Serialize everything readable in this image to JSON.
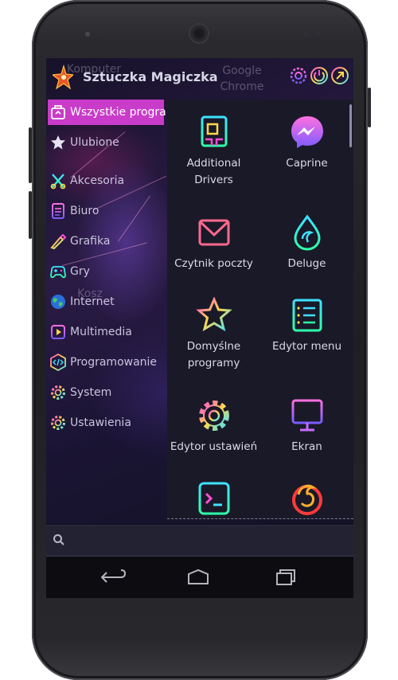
{
  "header": {
    "title": "Sztuczka Magiczka",
    "icons": [
      "settings-icon",
      "power-icon",
      "external-icon"
    ]
  },
  "desktop": {
    "ghost_icons": {
      "komputer": "Komputer",
      "chrome": "Google\nChrome",
      "kosz": "Kosz"
    }
  },
  "categories": [
    {
      "label": "Wszystkie programy",
      "icon": "all-programs-icon",
      "active": true
    },
    {
      "label": "Ulubione",
      "icon": "star-icon"
    },
    {
      "label": "Akcesoria",
      "icon": "accessories-icon"
    },
    {
      "label": "Biuro",
      "icon": "office-icon"
    },
    {
      "label": "Grafika",
      "icon": "graphics-icon"
    },
    {
      "label": "Gry",
      "icon": "gamepad-icon"
    },
    {
      "label": "Internet",
      "icon": "globe-icon"
    },
    {
      "label": "Multimedia",
      "icon": "multimedia-icon"
    },
    {
      "label": "Programowanie",
      "icon": "code-icon"
    },
    {
      "label": "System",
      "icon": "gear-icon"
    },
    {
      "label": "Ustawienia",
      "icon": "gear-icon"
    }
  ],
  "apps": [
    {
      "label": "Additional\nDrivers",
      "icon": "chip-icon"
    },
    {
      "label": "Caprine",
      "icon": "messenger-icon"
    },
    {
      "label": "Czytnik poczty",
      "icon": "mail-icon"
    },
    {
      "label": "Deluge",
      "icon": "droplet-icon"
    },
    {
      "label": "Domyślne\nprogramy",
      "icon": "star-icon"
    },
    {
      "label": "Edytor menu",
      "icon": "list-icon"
    },
    {
      "label": "Edytor ustawień",
      "icon": "gear-icon"
    },
    {
      "label": "Ekran",
      "icon": "monitor-icon"
    },
    {
      "label": "",
      "icon": "terminal-icon"
    },
    {
      "label": "",
      "icon": "firefox-icon"
    }
  ],
  "search": {
    "placeholder": ""
  },
  "navbar": {
    "buttons": [
      "back-icon",
      "home-icon",
      "recents-icon"
    ]
  },
  "colors": {
    "active_category": "#c93bc9",
    "screen_bg": "#0f0d1c",
    "grid_bg": "#1a1928",
    "icon_gradient": [
      "#ff4dd8",
      "#ffd84d",
      "#3de2ff"
    ]
  }
}
